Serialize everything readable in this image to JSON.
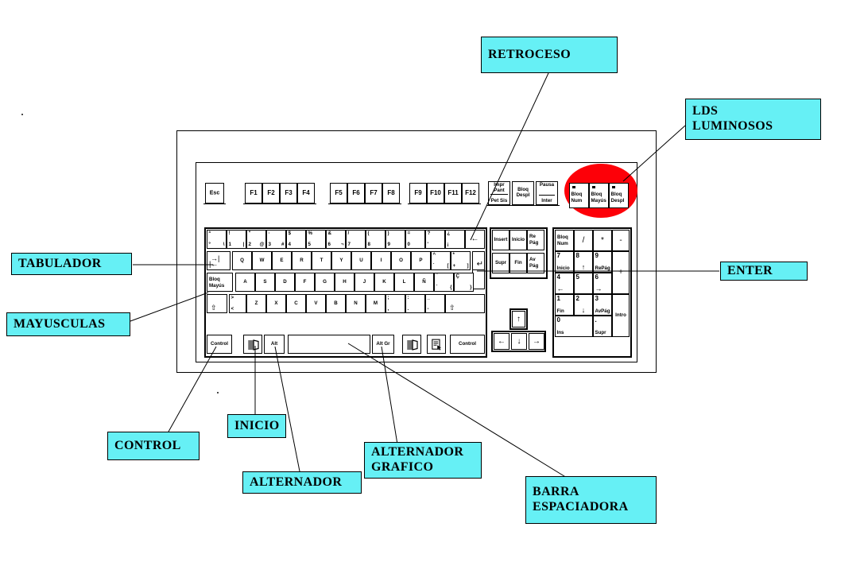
{
  "diagram": {
    "title": "Teclado - partes",
    "accent_color": "#66f0f5",
    "highlight_color": "#fd0008"
  },
  "callouts": [
    {
      "id": "retroceso",
      "text": "RETROCESO"
    },
    {
      "id": "lds-luminosos",
      "text": "LDS\nLUMINOSOS"
    },
    {
      "id": "tabulador",
      "text": "TABULADOR"
    },
    {
      "id": "mayusculas",
      "text": "MAYUSCULAS"
    },
    {
      "id": "enter",
      "text": "ENTER"
    },
    {
      "id": "control",
      "text": "CONTROL"
    },
    {
      "id": "inicio",
      "text": "INICIO"
    },
    {
      "id": "alternador",
      "text": "ALTERNADOR"
    },
    {
      "id": "alternador-grafico",
      "text": "ALTERNADOR\nGRAFICO"
    },
    {
      "id": "barra-espaciadora",
      "text": "BARRA\nESPACIADORA"
    }
  ],
  "keyboard": {
    "function_row": {
      "esc": "Esc",
      "f_group_1": [
        "F1",
        "F2",
        "F3",
        "F4"
      ],
      "f_group_2": [
        "F5",
        "F6",
        "F7",
        "F8"
      ],
      "f_group_3": [
        "F9",
        "F10",
        "F11",
        "F12"
      ],
      "sys_keys": [
        {
          "top": "Impr",
          "mid": "Pant",
          "bottom": "Pet Sis"
        },
        {
          "top": "Bloq",
          "mid": "Despl",
          "bottom": ""
        },
        {
          "top": "Pausa",
          "mid": "",
          "bottom": "Inter"
        }
      ],
      "leds": [
        {
          "label_top": "Bloq",
          "label_bottom": "Num"
        },
        {
          "label_top": "Bloq",
          "label_bottom": "Mayús"
        },
        {
          "label_top": "Bloq",
          "label_bottom": "Despl"
        }
      ]
    },
    "number_row": [
      {
        "tl": "ª",
        "bl": "º",
        "br": "\\"
      },
      {
        "tl": "!",
        "bl": "1",
        "br": "|"
      },
      {
        "tl": "\"",
        "bl": "2",
        "br": "@"
      },
      {
        "tl": "·",
        "bl": "3",
        "br": "#"
      },
      {
        "tl": "$",
        "bl": "4",
        "br": ""
      },
      {
        "tl": "%",
        "bl": "5",
        "br": ""
      },
      {
        "tl": "&",
        "bl": "6",
        "br": "¬"
      },
      {
        "tl": "/",
        "bl": "7",
        "br": ""
      },
      {
        "tl": "(",
        "bl": "8",
        "br": ""
      },
      {
        "tl": ")",
        "bl": "9",
        "br": ""
      },
      {
        "tl": "=",
        "bl": "0",
        "br": ""
      },
      {
        "tl": "?",
        "bl": "'",
        "br": ""
      },
      {
        "tl": "¿",
        "bl": "¡",
        "br": ""
      }
    ],
    "backspace": "←",
    "tab": {
      "glyph_top": "→|",
      "glyph_bottom": "|←"
    },
    "qwerty_row": [
      "Q",
      "W",
      "E",
      "R",
      "T",
      "Y",
      "U",
      "I",
      "O",
      "P"
    ],
    "qwerty_extra": [
      {
        "tl": "^",
        "bl": "`",
        "br": "["
      },
      {
        "tl": "*",
        "bl": "+",
        "br": "]"
      }
    ],
    "enter": "↵",
    "caps_lock": {
      "top": "Bloq",
      "bottom": "Mayús"
    },
    "asdf_row": [
      "A",
      "S",
      "D",
      "F",
      "G",
      "H",
      "J",
      "K",
      "L",
      "Ñ"
    ],
    "asdf_extra": [
      {
        "tl": "¨",
        "bl": "´",
        "br": "{"
      },
      {
        "tl": "Ç",
        "bl": "",
        "br": "}"
      }
    ],
    "shift_left_glyph": "⇧",
    "shift_right_glyph": "⇧",
    "zxcv_first": {
      "tl": ">",
      "bl": "<"
    },
    "zxcv_row": [
      "Z",
      "X",
      "C",
      "V",
      "B",
      "N",
      "M"
    ],
    "zxcv_extra": [
      {
        "tl": ";",
        "bl": ","
      },
      {
        "tl": ":",
        "bl": "."
      },
      {
        "tl": "_",
        "bl": "-"
      }
    ],
    "bottom_row": {
      "control_left": "Control",
      "win_left": "win-icon",
      "alt": "Alt",
      "space": "",
      "alt_gr": "Alt Gr",
      "win_right": "win-icon",
      "menu": "menu-icon",
      "control_right": "Control"
    },
    "nav_cluster": [
      {
        "top": "Insert",
        "bottom": ""
      },
      {
        "top": "Inicio",
        "bottom": ""
      },
      {
        "top": "Re",
        "bottom": "Pág"
      },
      {
        "top": "Supr",
        "bottom": ""
      },
      {
        "top": "Fin",
        "bottom": ""
      },
      {
        "top": "Av",
        "bottom": "Pág"
      }
    ],
    "arrows": {
      "up": "↑",
      "left": "←",
      "down": "↓",
      "right": "→"
    },
    "numpad": {
      "num_lock": {
        "top": "Bloq",
        "bottom": "Num"
      },
      "divide": "/",
      "multiply": "*",
      "minus": "-",
      "plus": "+",
      "enter": "Intro",
      "keys": [
        {
          "num": "7",
          "sub": "Inicio"
        },
        {
          "num": "8",
          "sub": "↑"
        },
        {
          "num": "9",
          "sub": "RePág"
        },
        {
          "num": "4",
          "sub": "←"
        },
        {
          "num": "5",
          "sub": ""
        },
        {
          "num": "6",
          "sub": "→"
        },
        {
          "num": "1",
          "sub": "Fin"
        },
        {
          "num": "2",
          "sub": "↓"
        },
        {
          "num": "3",
          "sub": "AvPág"
        },
        {
          "num": "0",
          "sub": "Ins"
        },
        {
          "num": ".",
          "sub": "Supr"
        }
      ]
    }
  }
}
